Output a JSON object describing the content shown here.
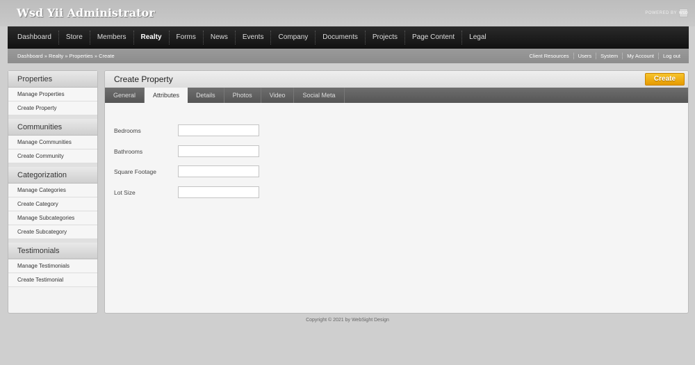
{
  "app": {
    "title": "Wsd Yii Administrator",
    "powered_by": "POWERED BY",
    "powered_logo": "WSD"
  },
  "nav": {
    "items": [
      "Dashboard",
      "Store",
      "Members",
      "Realty",
      "Forms",
      "News",
      "Events",
      "Company",
      "Documents",
      "Projects",
      "Page Content",
      "Legal"
    ],
    "active": "Realty"
  },
  "breadcrumb": "Dashboard » Realty » Properties » Create",
  "util_links": [
    "Client Resources",
    "Users",
    "System",
    "My Account",
    "Log out"
  ],
  "sidebar": {
    "sections": [
      {
        "title": "Properties",
        "items": [
          "Manage Properties",
          "Create Property"
        ]
      },
      {
        "title": "Communities",
        "items": [
          "Manage Communities",
          "Create Community"
        ]
      },
      {
        "title": "Categorization",
        "items": [
          "Manage Categories",
          "Create Category",
          "Manage Subcategories",
          "Create Subcategory"
        ]
      },
      {
        "title": "Testimonials",
        "items": [
          "Manage Testimonials",
          "Create Testimonial"
        ]
      }
    ]
  },
  "main": {
    "title": "Create Property",
    "create_label": "Create",
    "tabs": [
      "General",
      "Attributes",
      "Details",
      "Photos",
      "Video",
      "Social Meta"
    ],
    "active_tab": "Attributes",
    "fields": [
      {
        "label": "Bedrooms",
        "value": ""
      },
      {
        "label": "Bathrooms",
        "value": ""
      },
      {
        "label": "Square Footage",
        "value": ""
      },
      {
        "label": "Lot Size",
        "value": ""
      }
    ]
  },
  "footer": "Copyright © 2021 by WebSight Design"
}
